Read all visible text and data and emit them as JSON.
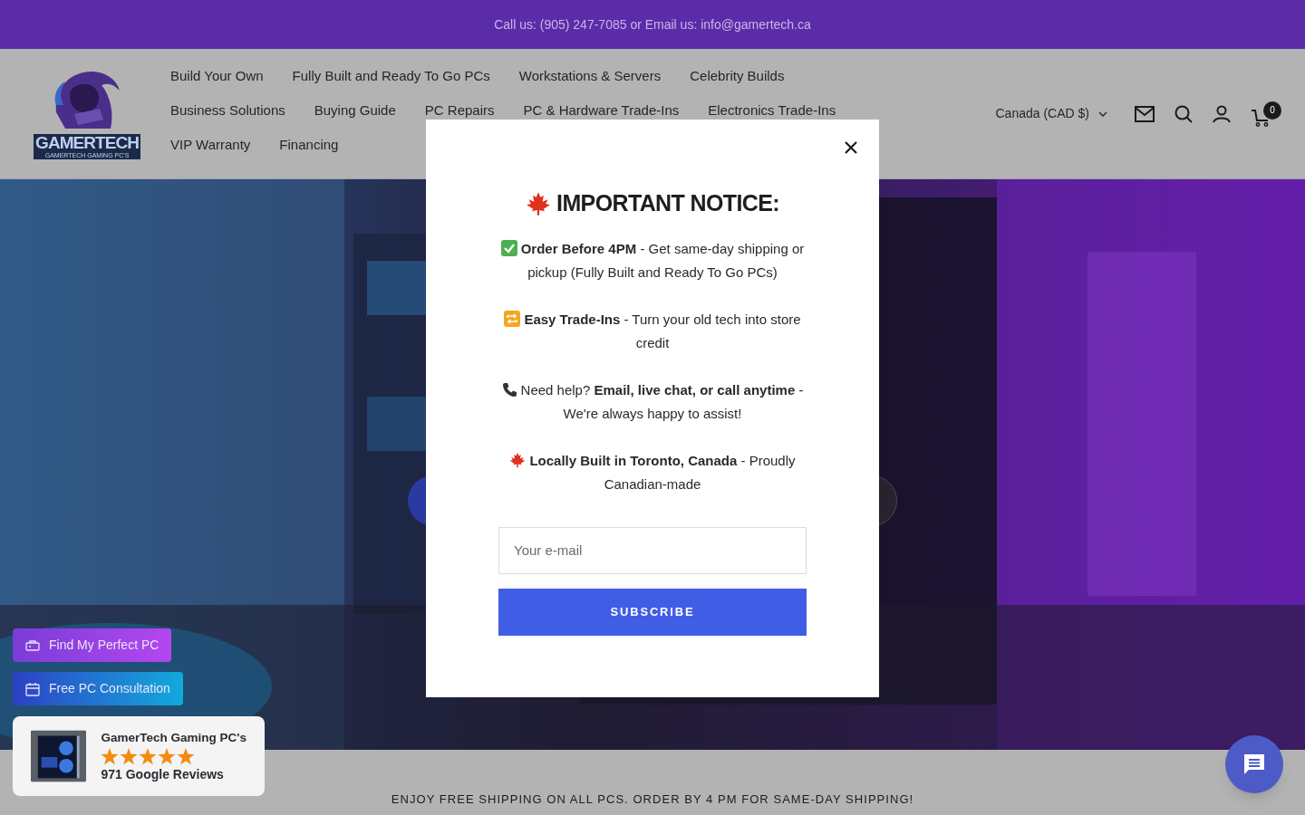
{
  "top_bar": {
    "text": "Call us: (905) 247-7085 or Email us: info@gamertech.ca"
  },
  "logo": {
    "title": "GAMERTECH",
    "subtitle": "GAMERTECH GAMING PC'S"
  },
  "nav": {
    "items": [
      "Build Your Own",
      "Fully Built and Ready To Go PCs",
      "Workstations & Servers",
      "Celebrity Builds",
      "Business Solutions",
      "Buying Guide",
      "PC Repairs",
      "PC & Hardware Trade-Ins",
      "Electronics Trade-Ins",
      "VIP Warranty",
      "Financing"
    ]
  },
  "currency": "Canada (CAD $)",
  "cart_count": "0",
  "modal": {
    "title": "IMPORTANT NOTICE:",
    "notices": [
      {
        "kind": "check",
        "text": "**Order Before 4PM** - Get same-day shipping or pickup (Fully Built and Ready To Go PCs)"
      },
      {
        "kind": "repeat",
        "text": "**Easy Trade-Ins** - Turn your old tech into store credit"
      },
      {
        "kind": "phone",
        "text": "Need help? **Email, live chat, or call anytime** - We're always happy to assist!"
      },
      {
        "kind": "maple",
        "text": "**Locally Built in Toronto, Canada** - Proudly Canadian-made"
      }
    ],
    "email_placeholder": "Your e-mail",
    "button": "SUBSCRIBE"
  },
  "floating_buttons": [
    {
      "kind": "finder",
      "label": "Find My Perfect PC"
    },
    {
      "kind": "consult",
      "label": "Free PC Consultation"
    }
  ],
  "review_card": {
    "title": "GamerTech Gaming PC's",
    "stars": 5,
    "count": "971 Google Reviews"
  },
  "shipping_banner": "ENJOY FREE SHIPPING ON ALL PCS. ORDER BY 4 PM FOR SAME-DAY SHIPPING!"
}
